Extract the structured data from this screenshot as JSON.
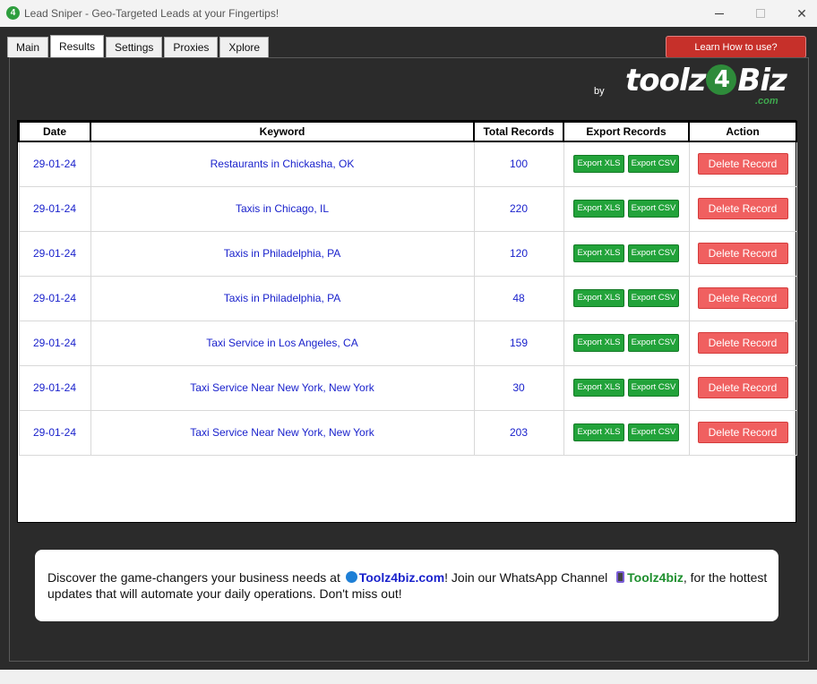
{
  "window": {
    "icon_glyph": "4",
    "title": "Lead Sniper - Geo-Targeted Leads at your Fingertips!",
    "close_glyph": "✕"
  },
  "tabs": [
    {
      "label": "Main"
    },
    {
      "label": "Results",
      "active": true
    },
    {
      "label": "Settings"
    },
    {
      "label": "Proxies"
    },
    {
      "label": "Xplore"
    }
  ],
  "learn_button": "Learn How to use?",
  "brand": {
    "by": "by",
    "logo_left": "toolz",
    "logo_four": "4",
    "logo_right": "Biz",
    "logo_suffix": ".com"
  },
  "table": {
    "headers": [
      "Date",
      "Keyword",
      "Total Records",
      "Export Records",
      "Action"
    ],
    "export_xls_label": "Export XLS",
    "export_csv_label": "Export CSV",
    "delete_label": "Delete Record",
    "rows": [
      {
        "date": "29-01-24",
        "keyword": "Restaurants in Chickasha, OK",
        "total": "100"
      },
      {
        "date": "29-01-24",
        "keyword": "Taxis in Chicago, IL",
        "total": "220"
      },
      {
        "date": "29-01-24",
        "keyword": "Taxis in Philadelphia, PA",
        "total": "120"
      },
      {
        "date": "29-01-24",
        "keyword": "Taxis in Philadelphia, PA",
        "total": "48"
      },
      {
        "date": "29-01-24",
        "keyword": "Taxi Service in Los Angeles, CA",
        "total": "159"
      },
      {
        "date": "29-01-24",
        "keyword": "Taxi Service Near New York, New York",
        "total": "30"
      },
      {
        "date": "29-01-24",
        "keyword": "Taxi Service Near New York, New York",
        "total": "203"
      }
    ]
  },
  "promo": {
    "part1": "Discover the game-changers your business needs at ",
    "site": "Toolz4biz.com",
    "part2": "! Join our WhatsApp Channel ",
    "channel": "Toolz4biz",
    "part3": ", for the hottest updates that will automate your daily operations. Don't miss out!"
  },
  "colors": {
    "background": "#2b2b2b",
    "accent_red": "#c6302a",
    "export_green": "#22a33a",
    "delete_red": "#f06060",
    "link_blue": "#1a22cc"
  }
}
